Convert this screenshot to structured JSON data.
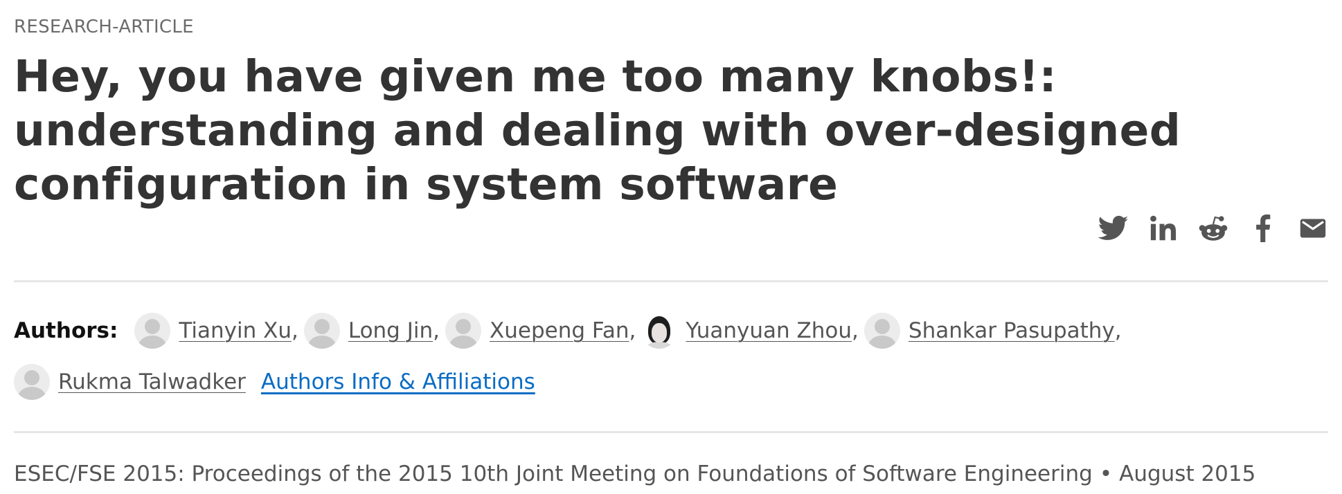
{
  "article_type": "RESEARCH-ARTICLE",
  "title": "Hey, you have given me too many knobs!: understanding and dealing with over-designed configuration in system software",
  "share_icons": [
    "twitter-icon",
    "linkedin-icon",
    "reddit-icon",
    "facebook-icon",
    "email-icon"
  ],
  "authors_label": "Authors:",
  "authors": [
    {
      "name": "Tianyin Xu",
      "sep": ","
    },
    {
      "name": "Long Jin",
      "sep": ","
    },
    {
      "name": "Xuepeng Fan",
      "sep": ","
    },
    {
      "name": "Yuanyuan Zhou",
      "sep": ","
    },
    {
      "name": "Shankar Pasupathy",
      "sep": ","
    },
    {
      "name": "Rukma Talwadker",
      "sep": ""
    }
  ],
  "affiliations_link": "Authors Info & Affiliations",
  "proceedings": {
    "venue": "ESEC/FSE 2015: Proceedings of the 2015 10th Joint Meeting on Foundations of Software Engineering",
    "bullet": "•",
    "date": "August 2015"
  },
  "colors": {
    "text": "#333333",
    "muted": "#555555",
    "link": "#0a6cc4",
    "icon": "#555555",
    "rule": "#e6e6e6"
  }
}
